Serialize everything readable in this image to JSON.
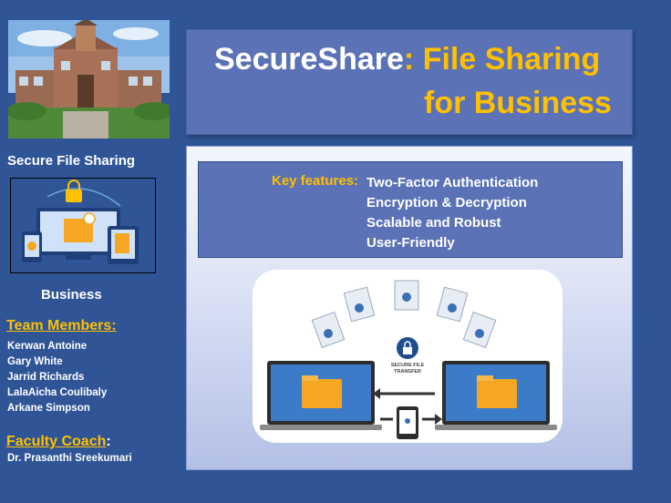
{
  "left_panel": {
    "heading": "Secure File Sharing",
    "caption": "Business",
    "team_title": "Team Members:",
    "team_members": [
      "Kerwan Antoine",
      "Gary White",
      "Jarrid Richards",
      "LalaAicha Coulibaly",
      "Arkane Simpson"
    ],
    "coach_title": "Faculty Coach",
    "coach_colon": ":",
    "coach_name": "Dr. Prasanthi Sreekumari"
  },
  "title": {
    "part1": "SecureShare",
    "part2": ": ",
    "part3": "File Sharing",
    "line2": "for Business"
  },
  "features": {
    "label": "Key features:",
    "items": [
      "Two-Factor Authentication",
      "Encryption & Decryption",
      "Scalable and Robust",
      "User-Friendly"
    ]
  },
  "diagram": {
    "caption": "SECURE FILE TRANSFER"
  },
  "colors": {
    "background": "#2f5597",
    "accent": "#ffc000",
    "panel": "#5b72b6"
  }
}
